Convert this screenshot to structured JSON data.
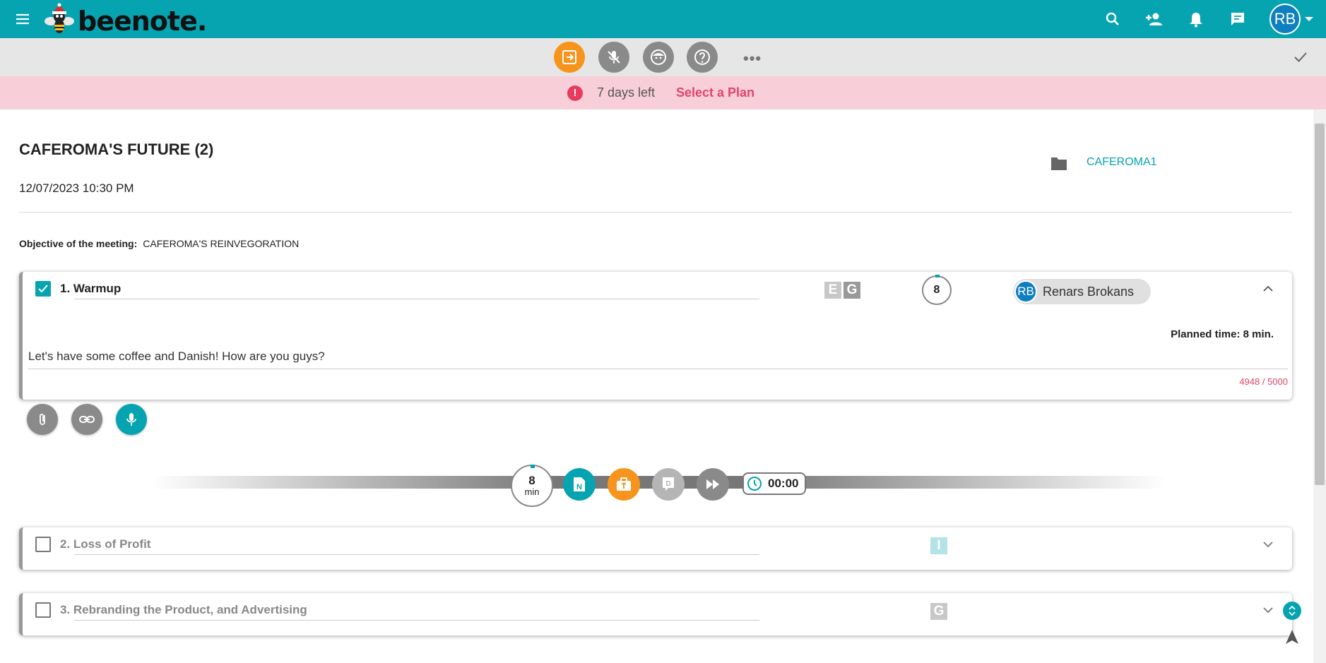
{
  "app": {
    "logo_text": "beenote."
  },
  "header": {
    "avatar_initials": "RB"
  },
  "banner": {
    "days_left": "7 days left",
    "plan_link": "Select a Plan"
  },
  "meeting": {
    "title": "CAFEROMA'S FUTURE (2)",
    "datetime": "12/07/2023 10:30 PM",
    "folder": "CAFEROMA1",
    "objective_label": "Objective of the meeting:",
    "objective_value": "CAFEROMA'S REINVEGORATION"
  },
  "agenda": [
    {
      "title": "1. Warmup",
      "checked": true,
      "tags": [
        "E",
        "G"
      ],
      "timer": "8",
      "assignee_initials": "RB",
      "assignee_name": "Renars Brokans",
      "planned_time": "Planned time: 8 min.",
      "description": "Let's have some coffee and Danish! How are you guys?",
      "char_count": "4948 / 5000"
    },
    {
      "title": "2. Loss of Profit",
      "checked": false,
      "tags": [
        "I"
      ]
    },
    {
      "title": "3. Rebranding the Product, and Advertising",
      "checked": false,
      "tags": [
        "G"
      ]
    }
  ],
  "controls": {
    "timer_value": "8",
    "timer_unit": "min",
    "note_letter": "N",
    "decision_letter": "D",
    "elapsed": "00:00"
  },
  "colors": {
    "brand": "#06a3b0",
    "accent": "#f7941d",
    "alert": "#e73c5e",
    "banner_bg": "#f8cfd8"
  }
}
